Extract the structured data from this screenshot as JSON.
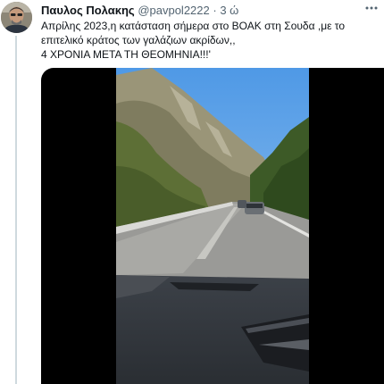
{
  "author": {
    "name": "Παυλος Πολακης",
    "handle": "@pavpol2222",
    "separator": "·",
    "time": "3 ώ"
  },
  "more_icon": "more-horizontal-icon",
  "tweet_text": {
    "line1": "Απρίλης  2023,η κατάσταση σήμερα  στο ΒΟΑΚ στη Σουδα ,με το",
    "line2": "επιτελικό κράτος των γαλάζιων ακρίδων,,",
    "line3": "4 ΧΡΟΝΙΑ ΜΕΤΑ ΤΗ ΘΕΟΜΗΝΙΑ!!!'"
  },
  "colors": {
    "name": "#0f1419",
    "secondary": "#536471",
    "thread_line": "#cfd9de",
    "media_background": "#000000"
  }
}
